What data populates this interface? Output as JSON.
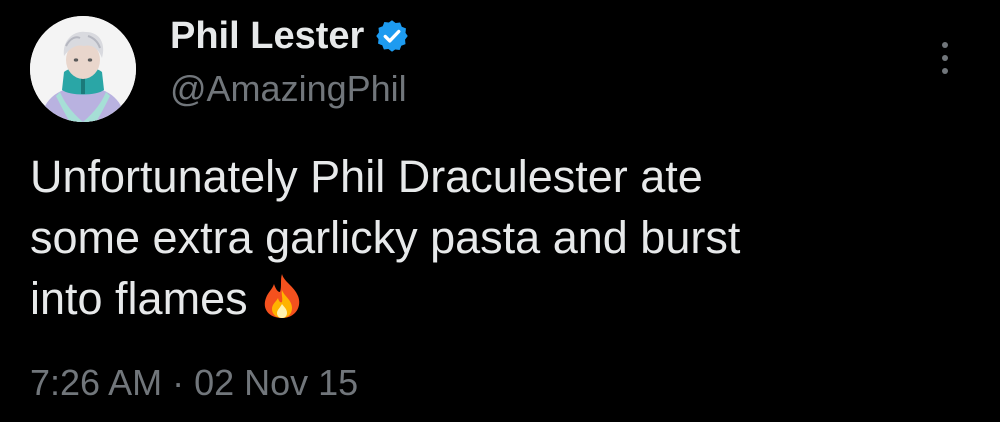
{
  "author": {
    "display_name": "Phil Lester",
    "handle": "@AmazingPhil",
    "verified": true,
    "avatar_icon": "profile-avatar"
  },
  "tweet": {
    "text_lines": [
      "Unfortunately Phil Draculester ate",
      "some extra garlicky pasta and burst",
      "into flames"
    ],
    "emoji": "fire-emoji",
    "time": "7:26 AM",
    "separator": "·",
    "date": "02 Nov 15"
  },
  "menu": {
    "icon": "more-options-icon"
  },
  "colors": {
    "background": "#000000",
    "primary_text": "#e7e9ea",
    "secondary_text": "#71767b",
    "verified_blue": "#1d9bf0"
  }
}
